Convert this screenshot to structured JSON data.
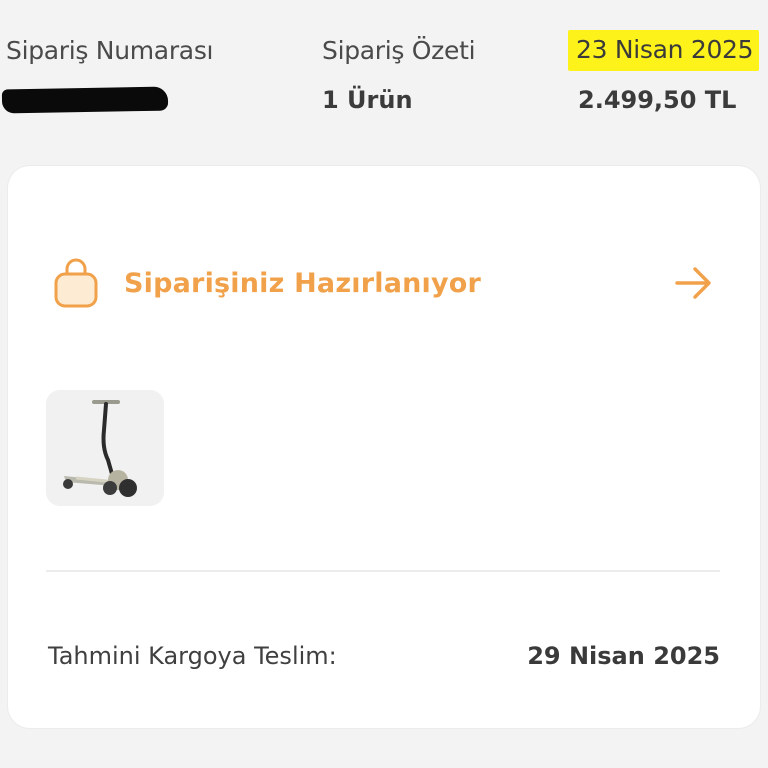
{
  "summary": {
    "order_number_label": "Sipariş Numarası",
    "order_summary_label": "Sipariş Özeti",
    "order_date": "23 Nisan 2025",
    "item_count": "1 Ürün",
    "total": "2.499,50 TL"
  },
  "status": {
    "text": "Siparişiniz Hazırlanıyor",
    "icon": "shopping-bag-icon",
    "action_icon": "arrow-right-icon",
    "accent_color": "#f0a14a"
  },
  "product": {
    "image": "kick-scooter"
  },
  "delivery": {
    "label": "Tahmini Kargoya Teslim:",
    "date": "29 Nisan 2025"
  },
  "colors": {
    "date_highlight": "#fdf21a",
    "card_background": "#ffffff",
    "page_background": "#f3f3f3"
  }
}
